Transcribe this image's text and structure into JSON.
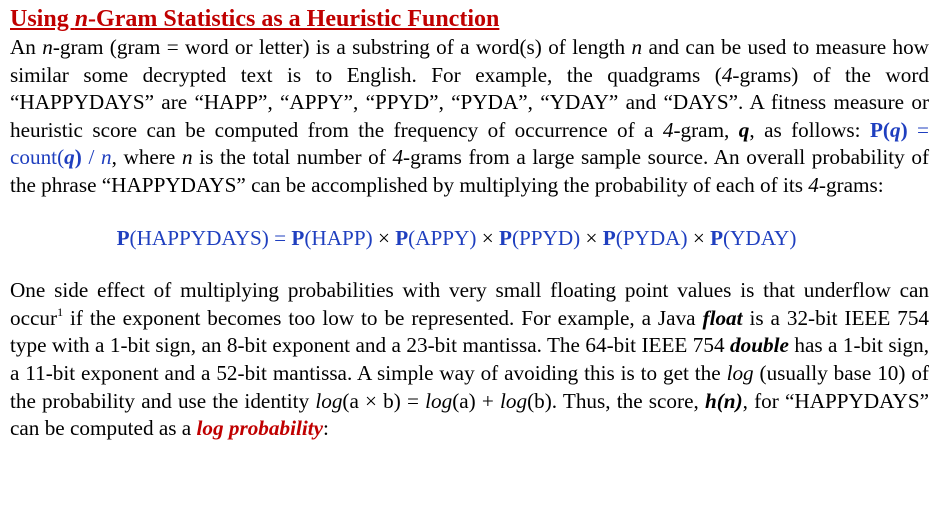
{
  "heading": {
    "t1": "Using ",
    "t2": "n",
    "t3": "-Gram Statistics as a Heuristic Function"
  },
  "p1": {
    "s1": "An ",
    "s2": "n",
    "s3": "-gram (gram = word or letter) is a substring of a word(s) of length ",
    "s4": "n",
    "s5": " and can be used to measure how similar some decrypted text is to English. For example, the quadgrams (",
    "s6": "4",
    "s7": "-grams) of the word “HAPPYDAYS” are “HAPP”, “APPY”, “PPYD”, “PYDA”, “YDAY” and “DAYS”. A fitness measure or heuristic score can be computed from the frequency of occurrence of a ",
    "s8": "4",
    "s9": "-gram, ",
    "s10": "q",
    "s11": ", as follows: ",
    "s12": "P(",
    "s13": "q",
    "s14": ")",
    "s15": " = count(",
    "s16": "q",
    "s17": ")",
    "s18": " / ",
    "s19": "n",
    "s20": ", where ",
    "s21": "n",
    "s22": " is the total number of ",
    "s23": "4",
    "s24": "-grams from a large sample source. An overall probability of the phrase “HAPPYDAYS” can be accomplished by multiplying the probability of each of its ",
    "s25": "4",
    "s26": "-grams:"
  },
  "equation": {
    "e1": "P",
    "e2": "(HAPPYDAYS) = ",
    "e3": "P",
    "e4": "(HAPP) ",
    "e5": "×",
    "e6": " ",
    "e7": "P",
    "e8": "(APPY) ",
    "e9": "×",
    "e10": " ",
    "e11": "P",
    "e12": "(PPYD) ",
    "e13": "×",
    "e14": " ",
    "e15": "P",
    "e16": "(PYDA) ",
    "e17": "×",
    "e18": " ",
    "e19": "P",
    "e20": "(YDAY)"
  },
  "p2": {
    "s1": "One side effect of multiplying probabilities with very small floating point values is that underflow can occur",
    "sup": "1",
    "s2": " if the exponent becomes too low to be represented. For example, a Java ",
    "s3": "float",
    "s4": " is a 32-bit IEEE 754 type with a 1-bit sign, an 8-bit exponent and a 23-bit mantissa. The 64-bit IEEE 754 ",
    "s5": "double",
    "s6": " has a 1-bit sign, a 11-bit exponent and a 52-bit mantissa. A simple way of avoiding this is to get the ",
    "s7": "log",
    "s8": " (usually base 10) of the probability and use the identity ",
    "s9": "log",
    "s10": "(a × b) = ",
    "s11": "log",
    "s12": "(a) + ",
    "s13": "log",
    "s14": "(b). Thus, the score, ",
    "s15": "h(n)",
    "s16": ", for “HAPPYDAYS” can be computed as a ",
    "s17": "log probability",
    "s18": ":"
  },
  "colors": {
    "heading": "#c00000",
    "emphasis_red": "#c00000",
    "formula_blue": "#1f3fbf"
  }
}
